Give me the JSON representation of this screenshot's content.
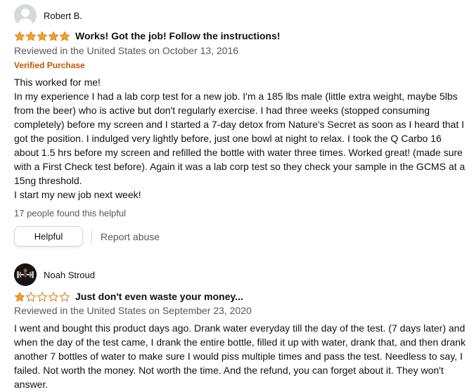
{
  "reviews": [
    {
      "reviewer": "Robert B.",
      "avatar": "default-avatar-icon",
      "rating": 5,
      "max_rating": 5,
      "title": "Works! Got the job! Follow the instructions!",
      "date": "Reviewed in the United States on October 13, 2016",
      "badge": "Verified Purchase",
      "body": [
        "This worked for me!",
        "In my experience I had a lab corp test for a new job. I'm a 185 lbs male (little extra weight, maybe 5lbs from the beer) who is active but don't regularly exercise. I had three weeks (stopped consuming completely) before my screen and I started a 7-day detox from Nature's Secret as soon as I heard that I got the position. I indulged very lightly before, just one bowl at night to relax. I took the Q Carbo 16 about 1.5 hrs before my screen and refilled the bottle with water three times. Worked great! (made sure with a First Check test before). Again it was a lab corp test so they check your sample in the GCMS at a 15ng threshold.",
        "I start my new job next week!"
      ],
      "helpful_count": "17 people found this helpful",
      "helpful_button": "Helpful",
      "report_link": "Report abuse"
    },
    {
      "reviewer": "Noah Stroud",
      "avatar": "profile-photo-icon",
      "rating": 1,
      "max_rating": 5,
      "title": "Just don't even waste your money...",
      "date": "Reviewed in the United States on September 23, 2020",
      "body": [
        "I went and bought this product days ago. Drank water everyday till the day of the test. (7 days later) and when the day of the test came, I drank the entire bottle, filled it up with water, drank that, and then drank another 7 bottles of water to make sure I would piss multiple times and pass the test. Needless to say, I failed. Not worth the money. Not worth the time. And the refund, you can forget about it. They won't answer."
      ]
    }
  ],
  "colors": {
    "star_filled": "#ffa41c",
    "star_outline": "#de7921",
    "verified": "#c45500",
    "meta_text": "#565959"
  }
}
